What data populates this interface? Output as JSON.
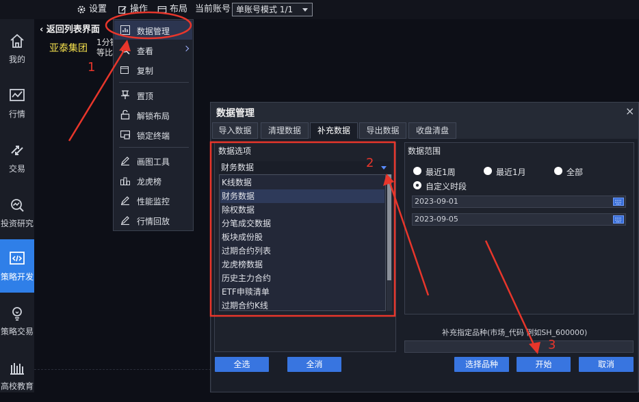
{
  "topbar": {
    "settings_label": "设置",
    "operate_label": "操作",
    "layout_label": "布局",
    "account_label": "当前账号",
    "account_mode": "单账号模式 1/1"
  },
  "sidebar": {
    "items": [
      {
        "label": "我的",
        "icon": "home-icon"
      },
      {
        "label": "行情",
        "icon": "chart-icon"
      },
      {
        "label": "交易",
        "icon": "trade-icon"
      },
      {
        "label": "投资研究",
        "icon": "research-icon"
      },
      {
        "label": "策略开发",
        "icon": "code-icon"
      },
      {
        "label": "策略交易",
        "icon": "bulb-icon"
      },
      {
        "label": "高校教育",
        "icon": "education-icon"
      }
    ],
    "active_index": 4
  },
  "main": {
    "back_label": "返回列表界面",
    "company": "亚泰集团",
    "desc_line1": "1分钟",
    "desc_line2": "等比"
  },
  "menu": {
    "items": [
      {
        "label": "数据管理",
        "icon": "bar-chart-icon"
      },
      {
        "label": "查看",
        "icon": "search-icon"
      },
      {
        "label": "复制",
        "icon": "copy-icon"
      },
      {
        "label": "置顶",
        "icon": "pin-icon"
      },
      {
        "label": "解锁布局",
        "icon": "unlock-icon"
      },
      {
        "label": "锁定终端",
        "icon": "lock-icon"
      },
      {
        "label": "画图工具",
        "icon": "pencil-icon"
      },
      {
        "label": "龙虎榜",
        "icon": "ranking-icon"
      },
      {
        "label": "性能监控",
        "icon": "monitor-icon"
      },
      {
        "label": "行情回放",
        "icon": "replay-icon"
      }
    ]
  },
  "dialog": {
    "title": "数据管理",
    "close": "×",
    "tabs": [
      "导入数据",
      "清理数据",
      "补充数据",
      "导出数据",
      "收盘清盘"
    ],
    "active_tab": 2,
    "options_title": "数据选项",
    "selected_option": "财务数据",
    "options": [
      "K线数据",
      "财务数据",
      "除权数据",
      "分笔成交数据",
      "板块成份股",
      "过期合约列表",
      "龙虎榜数据",
      "历史主力合约",
      "ETF申赎清单",
      "过期合约K线"
    ],
    "range_title": "数据范围",
    "range_options": [
      "最近1周",
      "最近1月",
      "全部",
      "自定义时段"
    ],
    "range_selected": "自定义时段",
    "start_date": "2023-09-01",
    "end_date": "2023-09-05",
    "spec_label": "补充指定品种(市场_代码 例如SH_600000)",
    "spec_value": "",
    "buttons": {
      "select_all": "全选",
      "clear_all": "全消",
      "choose": "选择品种",
      "start": "开始",
      "cancel": "取消"
    }
  },
  "annotations": {
    "step1": "1",
    "step2": "2",
    "step3": "3",
    "color": "#e8362b"
  },
  "colors": {
    "accent": "#3875e0",
    "sidebar_active": "#2f7fe8",
    "company": "#f4e04d"
  }
}
